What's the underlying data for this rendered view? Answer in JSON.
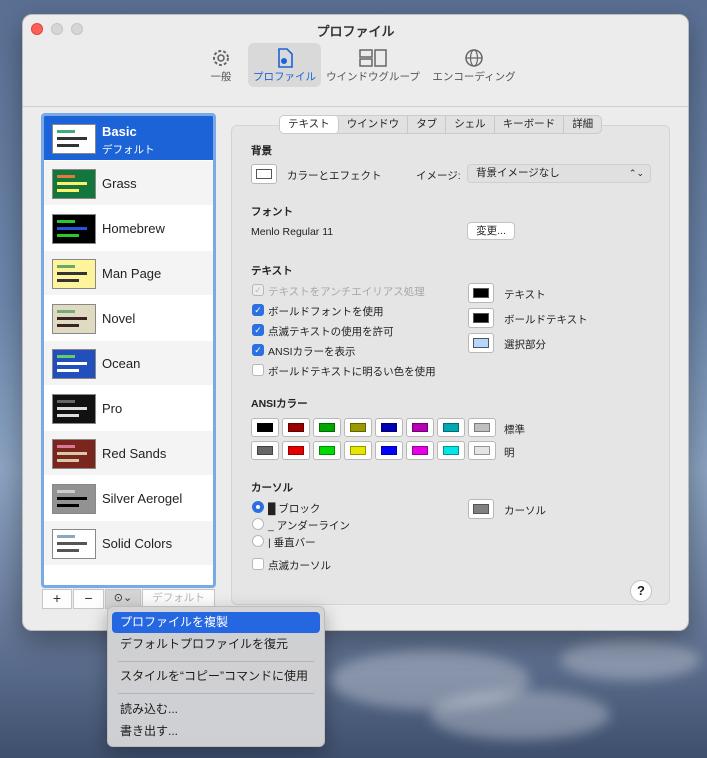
{
  "window": {
    "title": "プロファイル"
  },
  "toolbar": {
    "items": [
      {
        "label": "一般"
      },
      {
        "label": "プロファイル"
      },
      {
        "label": "ウインドウグループ"
      },
      {
        "label": "エンコーディング"
      }
    ]
  },
  "profiles": [
    {
      "name": "Basic",
      "sub": "デフォルト"
    },
    {
      "name": "Grass"
    },
    {
      "name": "Homebrew"
    },
    {
      "name": "Man Page"
    },
    {
      "name": "Novel"
    },
    {
      "name": "Ocean"
    },
    {
      "name": "Pro"
    },
    {
      "name": "Red Sands"
    },
    {
      "name": "Silver Aerogel"
    },
    {
      "name": "Solid Colors"
    }
  ],
  "sidebar_buttons": {
    "add": "+",
    "remove": "−",
    "action": "⊙⌄",
    "default": "デフォルト"
  },
  "tabs": [
    "テキスト",
    "ウインドウ",
    "タブ",
    "シェル",
    "キーボード",
    "詳細"
  ],
  "background": {
    "section": "背景",
    "color_effect": "カラーとエフェクト",
    "image_label": "イメージ:",
    "image_value": "背景イメージなし"
  },
  "font": {
    "section": "フォント",
    "value": "Menlo Regular 11",
    "change": "変更..."
  },
  "text": {
    "section": "テキスト",
    "options": [
      {
        "label": "テキストをアンチエイリアス処理",
        "state": "disabled"
      },
      {
        "label": "ボールドフォントを使用",
        "state": "checked"
      },
      {
        "label": "点滅テキストの使用を許可",
        "state": "checked"
      },
      {
        "label": "ANSIカラーを表示",
        "state": "checked"
      },
      {
        "label": "ボールドテキストに明るい色を使用",
        "state": "unchecked"
      }
    ],
    "colors": [
      {
        "label": "テキスト",
        "color": "#000000"
      },
      {
        "label": "ボールドテキスト",
        "color": "#000000"
      },
      {
        "label": "選択部分",
        "color": "#b3d7ff"
      }
    ]
  },
  "ansi": {
    "section": "ANSIカラー",
    "normal_label": "標準",
    "bright_label": "明",
    "normal": [
      "#000000",
      "#990000",
      "#00a600",
      "#999900",
      "#0000b2",
      "#b200b2",
      "#00a6b2",
      "#bfbfbf"
    ],
    "bright": [
      "#666666",
      "#e50000",
      "#00d900",
      "#e5e500",
      "#0000ff",
      "#e500e5",
      "#00e5e5",
      "#e5e5e5"
    ]
  },
  "cursor": {
    "section": "カーソル",
    "block": "█ ブロック",
    "underline": "_ アンダーライン",
    "bar": "| 垂直バー",
    "blink": "点滅カーソル",
    "color_label": "カーソル",
    "color": "#808080"
  },
  "help": "?",
  "menu": {
    "items": [
      "プロファイルを複製",
      "デフォルトプロファイルを復元",
      "スタイルを“コピー”コマンドに使用",
      "読み込む...",
      "書き出す..."
    ]
  }
}
